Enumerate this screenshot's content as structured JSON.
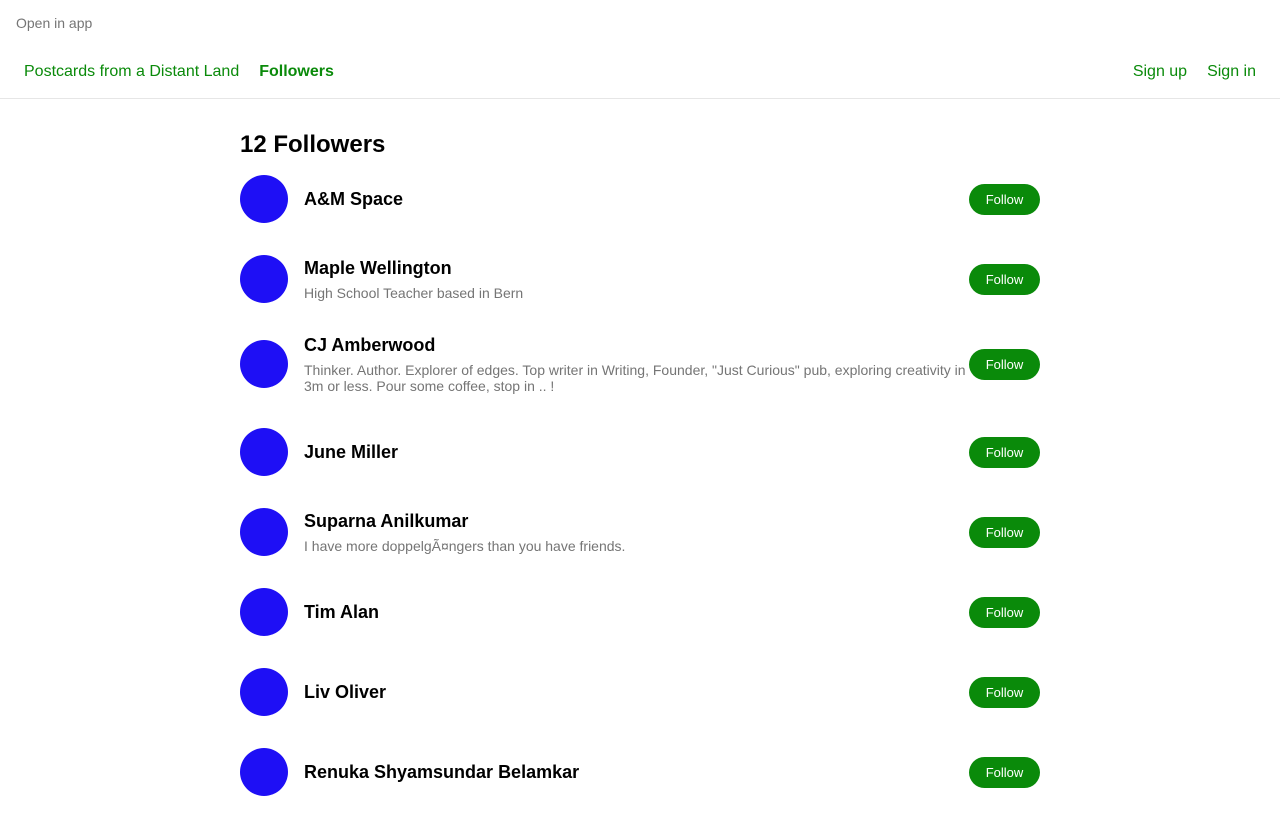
{
  "top_bar": {
    "open_in_app": "Open in app"
  },
  "nav": {
    "publication": "Postcards from a Distant Land",
    "followers": "Followers",
    "sign_up": "Sign up",
    "sign_in": "Sign in"
  },
  "page": {
    "title": "12 Followers"
  },
  "colors": {
    "accent_green": "#0a8a0a",
    "avatar_blue": "#1e0ff5",
    "muted_gray": "#757575"
  },
  "followers": [
    {
      "name": "A&M Space",
      "bio": "",
      "button": "Follow"
    },
    {
      "name": "Maple Wellington",
      "bio": "High School Teacher based in Bern",
      "button": "Follow"
    },
    {
      "name": "CJ Amberwood",
      "bio": "Thinker. Author. Explorer of edges. Top writer in Writing, Founder, \"Just Curious\" pub, exploring creativity in 3m or less. Pour some coffee, stop in .. !",
      "button": "Follow"
    },
    {
      "name": "June Miller",
      "bio": "",
      "button": "Follow"
    },
    {
      "name": "Suparna Anilkumar",
      "bio": "I have more doppelgÃ¤ngers than you have friends.",
      "button": "Follow"
    },
    {
      "name": "Tim Alan",
      "bio": "",
      "button": "Follow"
    },
    {
      "name": "Liv Oliver",
      "bio": "",
      "button": "Follow"
    },
    {
      "name": "Renuka Shyamsundar Belamkar",
      "bio": "",
      "button": "Follow"
    }
  ]
}
